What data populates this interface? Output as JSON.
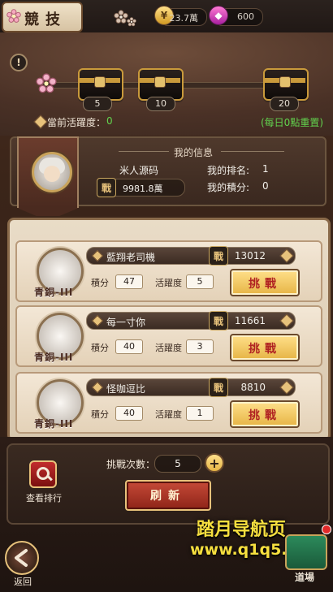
{
  "top_bar": {
    "title": "競技",
    "resources": [
      {
        "name": "gold",
        "icon": "coin-icon",
        "value": "23.7萬"
      },
      {
        "name": "gems",
        "icon": "gem-icon",
        "value": "600"
      }
    ]
  },
  "activity": {
    "label": "當前活躍度：",
    "value": "0",
    "reset_note": "(每日0點重置)",
    "milestones": [
      "5",
      "10",
      "20"
    ],
    "progress_fraction": 0.0
  },
  "my_info": {
    "heading": "我的信息",
    "player_name": "米人源码",
    "power": "9981.8萬",
    "rank_label": "我的排名:",
    "rank_value": "1",
    "score_label": "我的積分:",
    "score_value": "0"
  },
  "opponents": [
    {
      "name": "藍翔老司機",
      "power": "13012",
      "rank": "青銅-III",
      "score_label": "積分",
      "score": "47",
      "activity_label": "活躍度",
      "activity": "5",
      "button": "挑戰"
    },
    {
      "name": "每一寸你",
      "power": "11661",
      "rank": "青銅-III",
      "score_label": "積分",
      "score": "40",
      "activity_label": "活躍度",
      "activity": "3",
      "button": "挑戰"
    },
    {
      "name": "怪咖逗比",
      "power": "8810",
      "rank": "青銅-III",
      "score_label": "積分",
      "score": "40",
      "activity_label": "活躍度",
      "activity": "1",
      "button": "挑戰"
    }
  ],
  "bottom": {
    "leaderboard_label": "查看排行",
    "attempts_label": "挑戰次數：",
    "attempts_value": "5",
    "refresh_button": "刷新",
    "back_label": "返回",
    "dojo_label": "道場"
  },
  "watermark": {
    "line1": "踏月导航页",
    "line2": "www.q1q5.com"
  },
  "colors": {
    "accent_gold": "#e6b445",
    "highlight_green": "#62d34e",
    "challenge_text_red": "#b02222"
  }
}
